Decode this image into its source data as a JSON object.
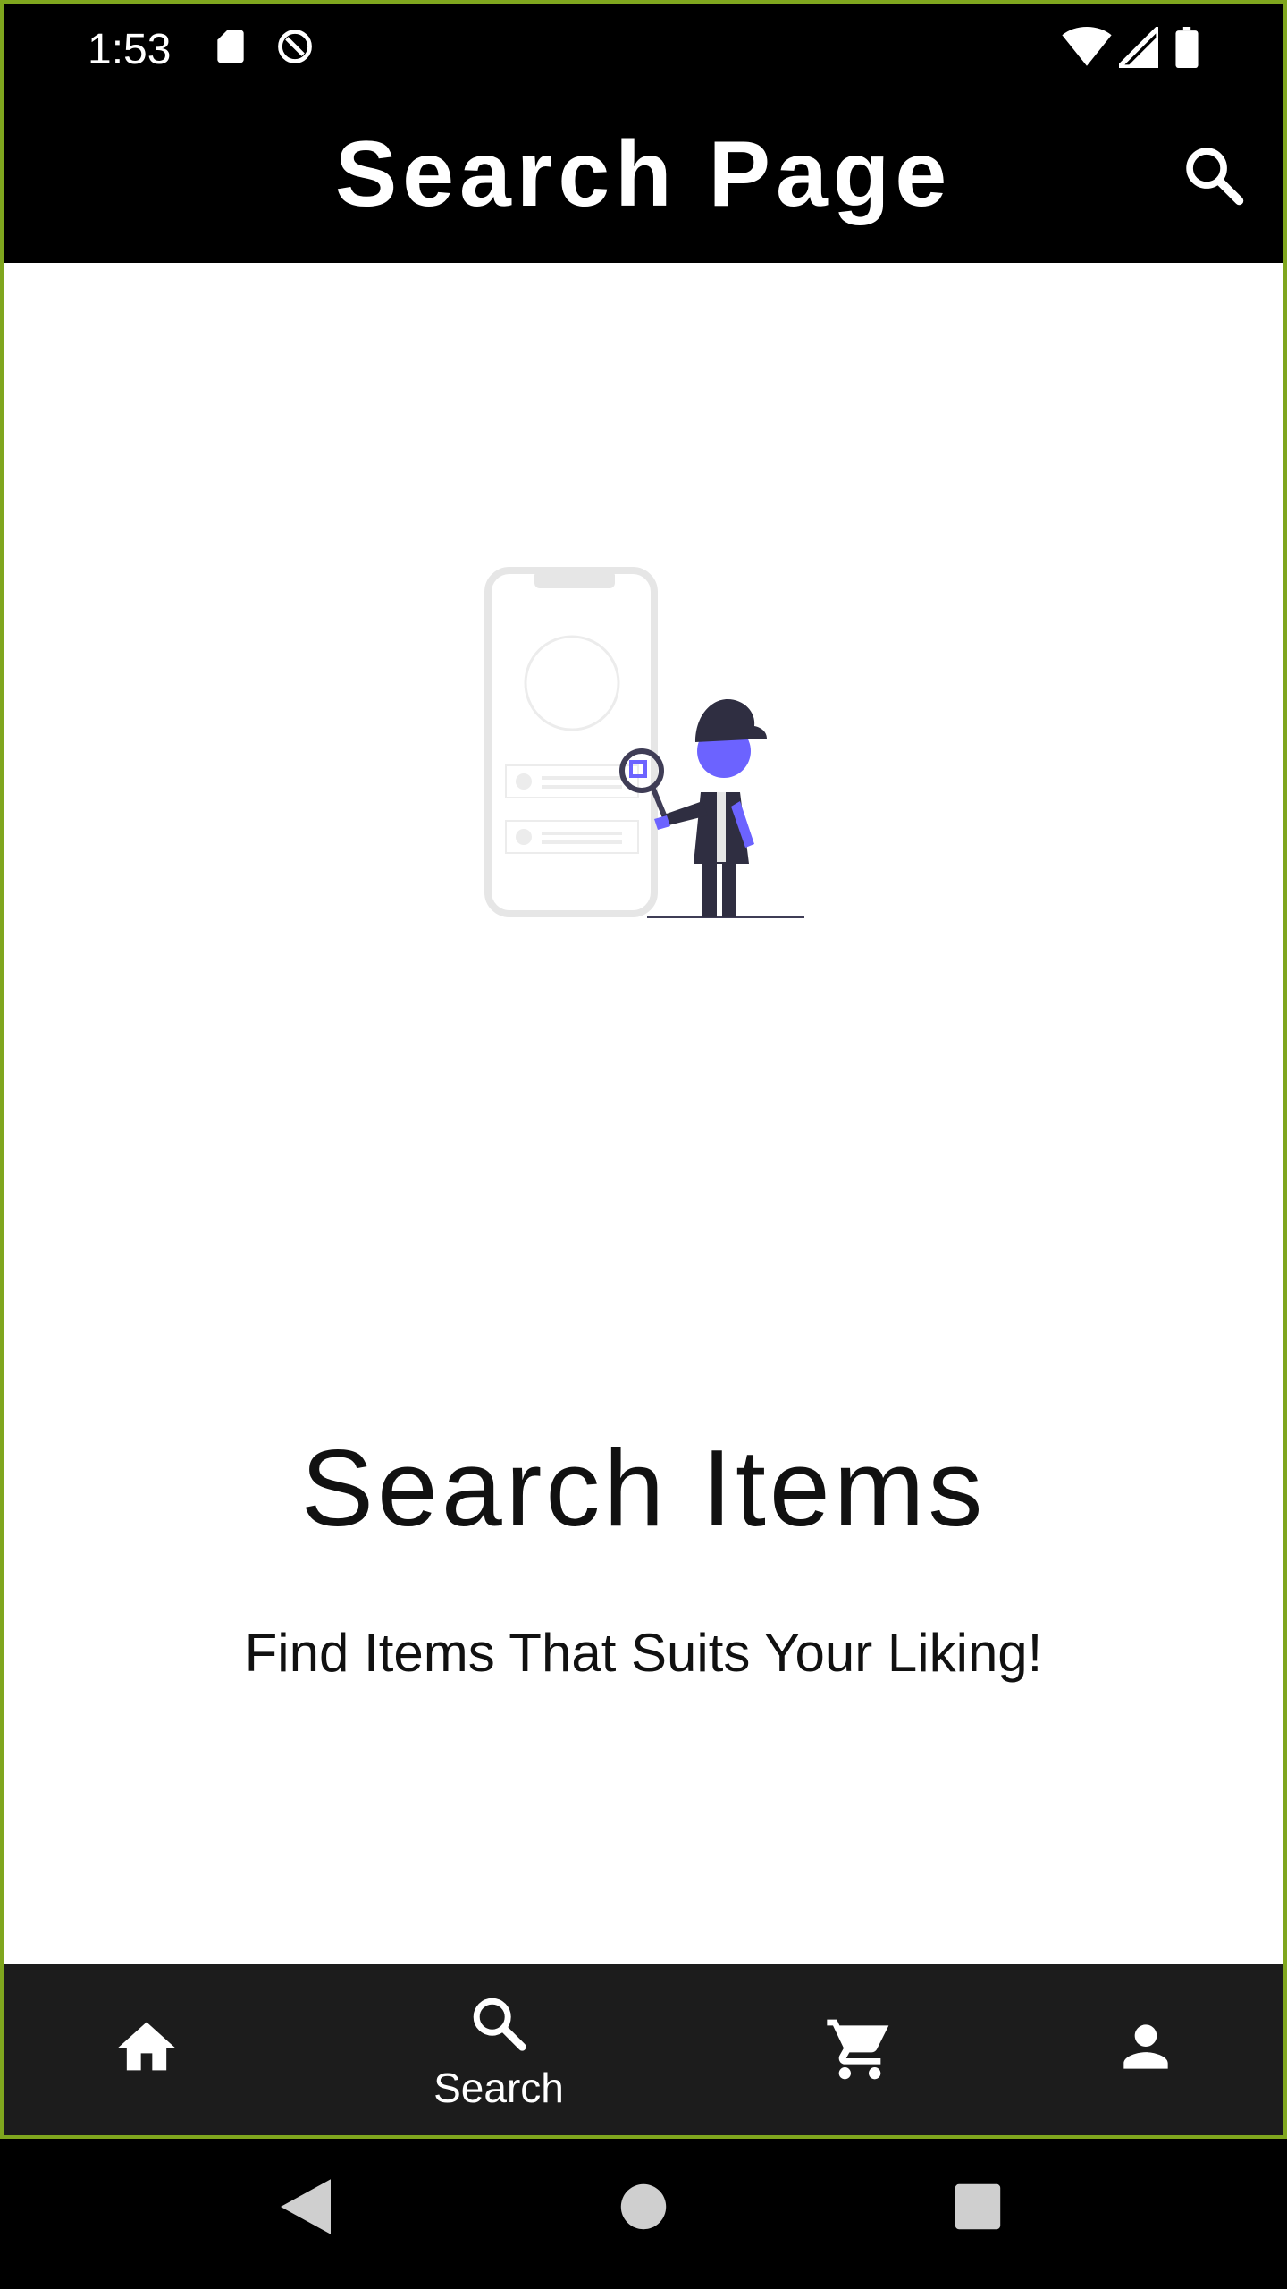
{
  "status_bar": {
    "time": "1:53",
    "icons_left": [
      "sd-card-icon",
      "data-saver-icon"
    ],
    "icons_right": [
      "wifi-icon",
      "cell-signal-icon",
      "battery-icon"
    ]
  },
  "app_bar": {
    "title": "Search Page",
    "action_icon": "search-icon"
  },
  "empty_state": {
    "illustration": "person-with-magnifier-illustration",
    "title": "Search Items",
    "subtitle": "Find Items That Suits Your Liking!"
  },
  "bottom_nav": {
    "items": [
      {
        "icon": "home-icon",
        "label": "",
        "active": false
      },
      {
        "icon": "search-icon",
        "label": "Search",
        "active": true
      },
      {
        "icon": "cart-icon",
        "label": "",
        "active": false
      },
      {
        "icon": "person-icon",
        "label": "",
        "active": false
      }
    ]
  },
  "system_nav": [
    "back-icon",
    "home-circle-icon",
    "recents-icon"
  ],
  "colors": {
    "app_bar_bg": "#000000",
    "bottom_nav_bg": "#1c1c1c",
    "accent_illustration": "#6c63ff",
    "frame_border": "#7fa61e"
  }
}
